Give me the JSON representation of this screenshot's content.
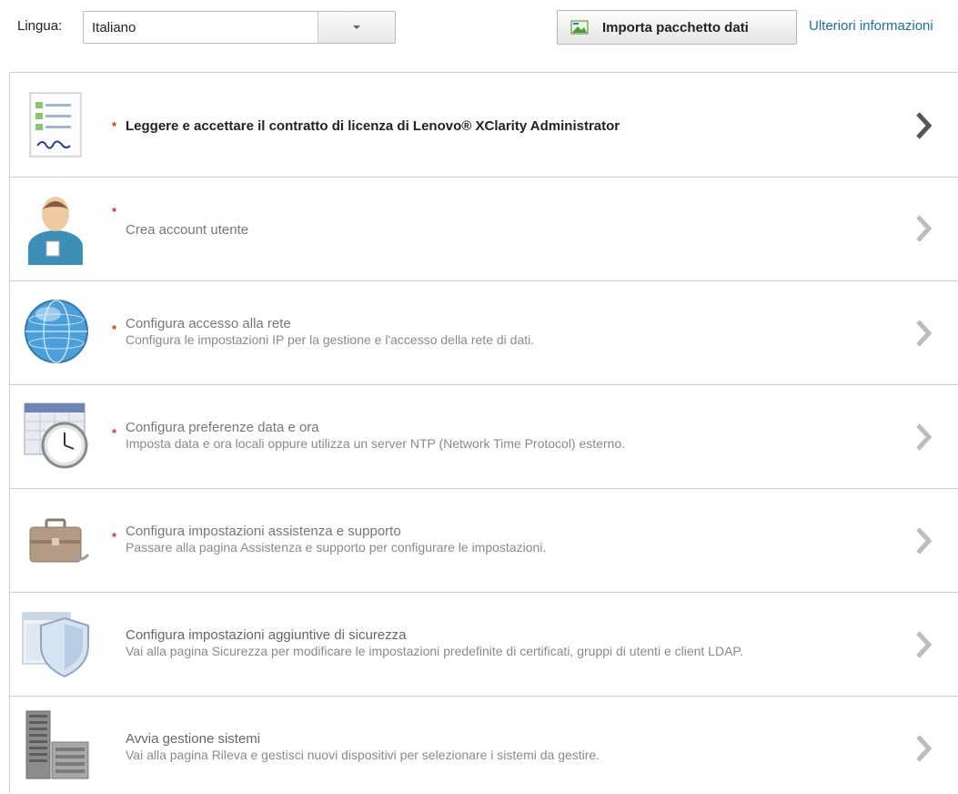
{
  "topbar": {
    "language_label": "Lingua:",
    "language_value": "Italiano",
    "import_button_label": "Importa pacchetto dati",
    "more_info_link": "Ulteriori informazioni"
  },
  "tasks": [
    {
      "title": "Leggere e accettare il contratto di licenza di Lenovo® XClarity Administrator",
      "description": "",
      "required": true,
      "active": true,
      "icon": "license-document-icon"
    },
    {
      "title": "Crea account utente",
      "description": "",
      "required": true,
      "active": false,
      "icon": "user-account-icon"
    },
    {
      "title": "Configura accesso alla rete",
      "description": "Configura le impostazioni IP per la gestione e l'accesso della rete di dati.",
      "required": true,
      "active": false,
      "icon": "globe-icon"
    },
    {
      "title": "Configura preferenze data e ora",
      "description": "Imposta data e ora locali oppure utilizza un server NTP (Network Time Protocol) esterno.",
      "required": true,
      "active": false,
      "icon": "calendar-clock-icon"
    },
    {
      "title": "Configura impostazioni assistenza e supporto",
      "description": "Passare alla pagina Assistenza e supporto per configurare le impostazioni.",
      "required": true,
      "active": false,
      "icon": "briefcase-icon"
    },
    {
      "title": "Configura impostazioni aggiuntive di sicurezza",
      "description": "Vai alla pagina Sicurezza per modificare le impostazioni predefinite di certificati, gruppi di utenti e client LDAP.",
      "required": false,
      "active": false,
      "icon": "security-shield-icon"
    },
    {
      "title": "Avvia gestione sistemi",
      "description": "Vai alla pagina Rileva e gestisci nuovi dispositivi per selezionare i sistemi da gestire.",
      "required": false,
      "active": false,
      "icon": "server-rack-icon"
    }
  ],
  "colors": {
    "required_marker": "#c0392b",
    "link": "#1a6bb5",
    "border": "#cfcfcf"
  }
}
